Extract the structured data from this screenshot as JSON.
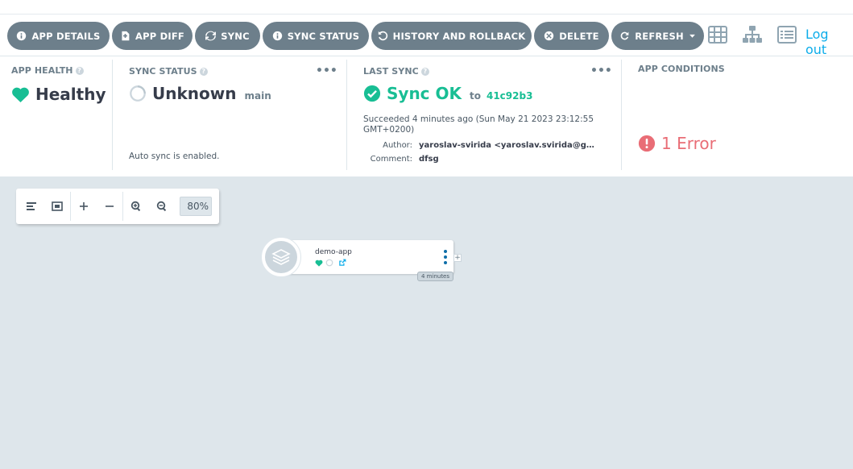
{
  "toolbar": {
    "buttons": [
      {
        "label": "APP DETAILS",
        "icon": "info-circle-icon"
      },
      {
        "label": "APP DIFF",
        "icon": "file-diff-icon"
      },
      {
        "label": "SYNC",
        "icon": "sync-icon"
      },
      {
        "label": "SYNC STATUS",
        "icon": "info-circle-icon"
      },
      {
        "label": "HISTORY AND ROLLBACK",
        "icon": "history-icon"
      },
      {
        "label": "DELETE",
        "icon": "times-circle-icon"
      },
      {
        "label": "REFRESH",
        "icon": "refresh-icon"
      }
    ],
    "views": [
      "tree-grid-view-icon",
      "network-view-icon",
      "list-view-icon"
    ],
    "logout_label": "Log out"
  },
  "status": {
    "app_health": {
      "title": "APP HEALTH",
      "value": "Healthy",
      "color": "#18be94"
    },
    "sync_status": {
      "title": "SYNC STATUS",
      "value": "Unknown",
      "revision": "main",
      "auto_sync": "Auto sync is enabled.",
      "menu": "•••"
    },
    "last_sync": {
      "title": "LAST SYNC",
      "value": "Sync OK",
      "to_label": "to",
      "commit": "41c92b3",
      "detail": "Succeeded 4 minutes ago (Sun May 21 2023 23:12:55 GMT+0200)",
      "author_label": "Author:",
      "author_value": "yaroslav-svirida <yaroslav.svirida@gmail.com>",
      "comment_label": "Comment:",
      "comment_value": "dfsg",
      "menu": "•••",
      "color": "#18be94"
    },
    "app_conditions": {
      "title": "APP CONDITIONS",
      "value": "1 Error",
      "color": "#e96d76"
    }
  },
  "graph": {
    "zoom": "80%",
    "node": {
      "name": "demo-app",
      "age": "4 minutes",
      "health_icon": "heart-icon",
      "sync_icon": "sync-unknown-circle-icon",
      "link_icon": "external-link-icon"
    }
  },
  "colors": {
    "button_bg": "#6d7f8b",
    "accent": "#0dadea",
    "graph_bg": "#dee6eb"
  }
}
